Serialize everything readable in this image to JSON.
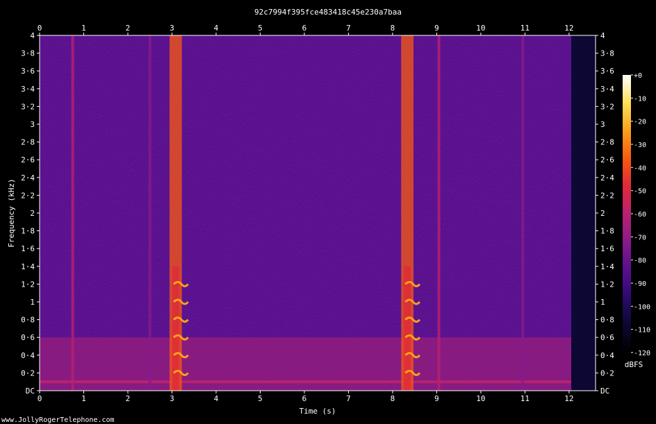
{
  "chart_data": {
    "type": "heatmap",
    "title": "92c7994f395fce483418c45e230a7baa",
    "xlabel": "Time (s)",
    "ylabel": "Frequency (kHz)",
    "xlim": [
      0,
      12.6
    ],
    "ylim": [
      0,
      4
    ],
    "x_ticks": [
      {
        "value": 0,
        "label": "0"
      },
      {
        "value": 1,
        "label": "1"
      },
      {
        "value": 2,
        "label": "2"
      },
      {
        "value": 3,
        "label": "3"
      },
      {
        "value": 4,
        "label": "4"
      },
      {
        "value": 5,
        "label": "5"
      },
      {
        "value": 6,
        "label": "6"
      },
      {
        "value": 7,
        "label": "7"
      },
      {
        "value": 8,
        "label": "8"
      },
      {
        "value": 9,
        "label": "9"
      },
      {
        "value": 10,
        "label": "10"
      },
      {
        "value": 11,
        "label": "11"
      },
      {
        "value": 12,
        "label": "12"
      }
    ],
    "y_ticks": [
      {
        "value": 0,
        "label": "DC"
      },
      {
        "value": 0.2,
        "label": "0·2"
      },
      {
        "value": 0.4,
        "label": "0·4"
      },
      {
        "value": 0.6,
        "label": "0·6"
      },
      {
        "value": 0.8,
        "label": "0·8"
      },
      {
        "value": 1,
        "label": "1"
      },
      {
        "value": 1.2,
        "label": "1·2"
      },
      {
        "value": 1.4,
        "label": "1·4"
      },
      {
        "value": 1.6,
        "label": "1·6"
      },
      {
        "value": 1.8,
        "label": "1·8"
      },
      {
        "value": 2,
        "label": "2"
      },
      {
        "value": 2.2,
        "label": "2·2"
      },
      {
        "value": 2.4,
        "label": "2·4"
      },
      {
        "value": 2.6,
        "label": "2·6"
      },
      {
        "value": 2.8,
        "label": "2·8"
      },
      {
        "value": 3,
        "label": "3"
      },
      {
        "value": 3.2,
        "label": "3·2"
      },
      {
        "value": 3.4,
        "label": "3·4"
      },
      {
        "value": 3.6,
        "label": "3·6"
      },
      {
        "value": 3.8,
        "label": "3·8"
      },
      {
        "value": 4,
        "label": "4"
      }
    ],
    "colorbar": {
      "label": "dBFS",
      "range": [
        -120,
        0
      ],
      "ticks": [
        {
          "value": 0,
          "label": "+0"
        },
        {
          "value": -10,
          "label": "-10"
        },
        {
          "value": -20,
          "label": "-20"
        },
        {
          "value": -30,
          "label": "-30"
        },
        {
          "value": -40,
          "label": "-40"
        },
        {
          "value": -50,
          "label": "-50"
        },
        {
          "value": -60,
          "label": "-60"
        },
        {
          "value": -70,
          "label": "-70"
        },
        {
          "value": -80,
          "label": "-80"
        },
        {
          "value": -90,
          "label": "-90"
        },
        {
          "value": -100,
          "label": "-100"
        },
        {
          "value": -110,
          "label": "-110"
        },
        {
          "value": -120,
          "label": "-120"
        }
      ],
      "colors": [
        "#000000",
        "#0c0733",
        "#2b0b6e",
        "#5a0f8c",
        "#8a1a8c",
        "#b8226e",
        "#e02a3a",
        "#f85a10",
        "#fba01a",
        "#fde05a",
        "#ffffff"
      ]
    },
    "background_level": -85,
    "events": [
      {
        "time_start": 2.85,
        "time_end": 3.35,
        "level": -40,
        "pitch_hz": 200,
        "peak_level": -20
      },
      {
        "time_start": 8.1,
        "time_end": 8.6,
        "level": -40,
        "pitch_hz": 200,
        "peak_level": -20
      }
    ],
    "clicks": [
      {
        "time": 0.75,
        "level": -55
      },
      {
        "time": 2.5,
        "level": -70
      },
      {
        "time": 9.05,
        "level": -55
      },
      {
        "time": 10.95,
        "level": -70
      }
    ],
    "hum_band": {
      "freq_khz": 0.1,
      "level": -55
    },
    "silence_after": 12.05,
    "grid": false
  },
  "watermark": "www.JollyRogerTelephone.com"
}
